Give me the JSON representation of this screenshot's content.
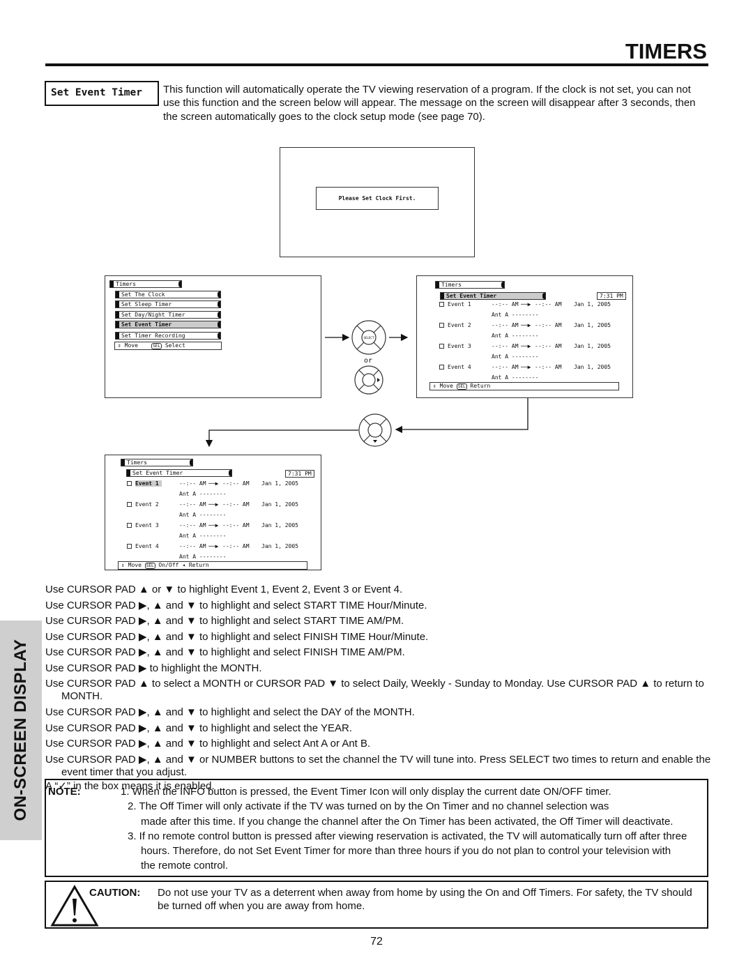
{
  "header": {
    "title": "TIMERS"
  },
  "section": {
    "label": "Set Event Timer",
    "intro": "This function will automatically operate the TV viewing reservation of a program.  If the clock is not set, you can not use this function and the screen below will appear.  The message on the screen will disappear after 3 seconds, then the screen automatically goes to the clock setup mode (see page 70)."
  },
  "clock_screen": {
    "message": "Please Set Clock First."
  },
  "menu1": {
    "title": "Timers",
    "items": [
      "Set The Clock",
      "Set Sleep Timer",
      "Set Day/Night Timer",
      "Set Event Timer",
      "Set Timer Recording"
    ],
    "highlighted": "Set Event Timer",
    "footer_move": "Move",
    "footer_sel": "SEL",
    "footer_select": "Select"
  },
  "remote": {
    "select_label": "SELECT",
    "or": "or"
  },
  "menu2": {
    "title": "Timers",
    "subtitle": "Set Event Timer",
    "clock": "7:31 PM",
    "footer_move": "Move",
    "footer_sel": "SEL",
    "footer_return": "Return"
  },
  "menu3": {
    "title": "Timers",
    "subtitle": "Set Event Timer",
    "clock": "7:31 PM",
    "highlighted": "Event 1",
    "footer_move": "Move",
    "footer_sel": "SEL",
    "footer_onoff": "On/Off",
    "footer_return": "Return"
  },
  "events": [
    {
      "name": "Event 1",
      "start": "--:-- AM",
      "finish": "--:-- AM",
      "date": "Jan 1, 2005",
      "ant": "Ant A --------"
    },
    {
      "name": "Event 2",
      "start": "--:-- AM",
      "finish": "--:-- AM",
      "date": "Jan 1, 2005",
      "ant": "Ant A --------"
    },
    {
      "name": "Event 3",
      "start": "--:-- AM",
      "finish": "--:-- AM",
      "date": "Jan 1, 2005",
      "ant": "Ant A --------"
    },
    {
      "name": "Event 4",
      "start": "--:-- AM",
      "finish": "--:-- AM",
      "date": "Jan 1, 2005",
      "ant": "Ant A --------"
    }
  ],
  "instructions": [
    "Use CURSOR PAD ▲ or ▼ to highlight Event 1, Event 2, Event 3 or Event 4.",
    "Use CURSOR PAD ▶, ▲ and ▼ to highlight and select START TIME Hour/Minute.",
    "Use CURSOR PAD ▶, ▲ and ▼ to highlight and select START TIME AM/PM.",
    "Use CURSOR PAD ▶, ▲ and ▼ to highlight and select FINISH TIME Hour/Minute.",
    "Use CURSOR PAD ▶, ▲ and ▼ to highlight and select FINISH TIME AM/PM.",
    "Use CURSOR PAD ▶ to highlight the MONTH.",
    "Use CURSOR PAD ▲ to select a MONTH or CURSOR PAD ▼ to select Daily, Weekly - Sunday to Monday.  Use CURSOR PAD ▲ to return to MONTH.",
    "Use CURSOR PAD ▶, ▲ and ▼ to highlight and select the DAY of the MONTH.",
    "Use CURSOR PAD ▶, ▲ and ▼ to highlight and select the YEAR.",
    "Use CURSOR PAD ▶, ▲ and ▼ to highlight and select Ant A or Ant B.",
    "Use CURSOR PAD ▶, ▲ and ▼ or NUMBER buttons to set the channel the TV will tune into. Press SELECT two times to return and enable the event timer that you adjust."
  ],
  "enabled_note": "A “✓” in the box means it is enabled.",
  "side_tab": "ON-SCREEN DISPLAY",
  "note": {
    "label": "NOTE:",
    "items": [
      "1. When the INFO button is pressed, the Event Timer Icon will only display the current date ON/OFF timer.",
      "2. The Off Timer will only activate if the TV was turned on by the On Timer and no channel selection was",
      "made after this time.  If you change the channel after the On Timer has been activated, the Off Timer will deactivate.",
      "3. If no remote control button is pressed after viewing reservation is activated, the TV will automatically turn off after three",
      "hours.  Therefore, do not Set Event Timer for more than three hours if you do not plan to control your television with",
      "the remote control."
    ]
  },
  "caution": {
    "label": "CAUTION:",
    "text": "Do not use your TV as a deterrent when away from home by using the On and Off Timers.  For safety, the TV should be turned off when you are away from home."
  },
  "page_number": "72"
}
